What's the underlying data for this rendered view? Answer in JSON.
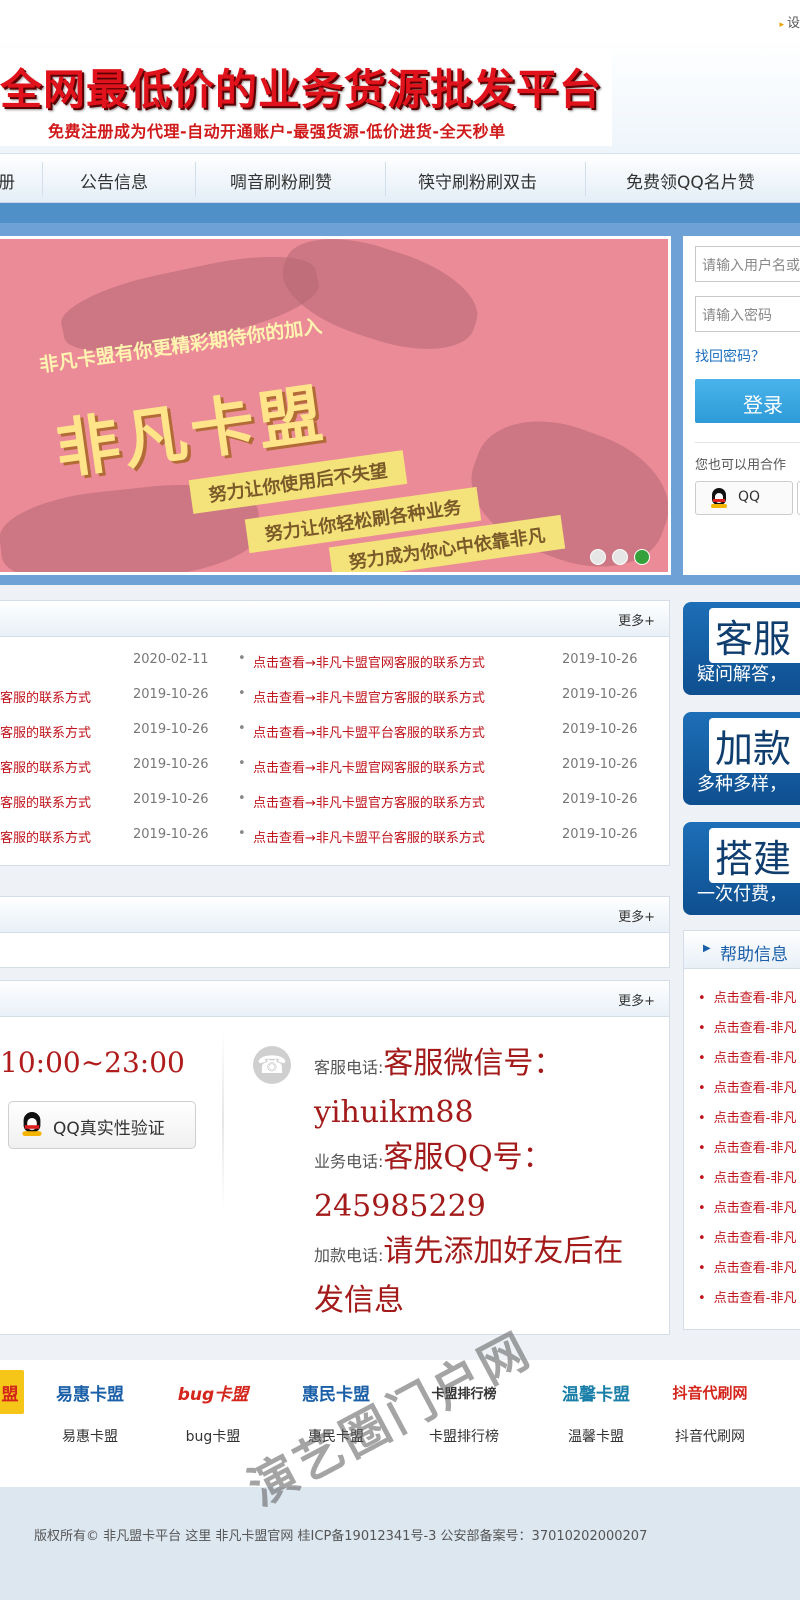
{
  "topbar": {
    "settings_label": "设"
  },
  "header": {
    "slogan": "全网最低价的业务货源批发平台",
    "subslogan": "免费注册成为代理-自动开通账户-最强货源-低价进货-全天秒单"
  },
  "nav": {
    "items": [
      {
        "label": "册"
      },
      {
        "label": "公告信息"
      },
      {
        "label": "啁音刷粉刷赞"
      },
      {
        "label": "筷守刷粉刷双击"
      },
      {
        "label": "免费领QQ名片赞"
      }
    ]
  },
  "slider": {
    "tagline": "非凡卡盟有你更精彩期待你的加入",
    "brand": "非凡卡盟",
    "bands": [
      "努力让你使用后不失望",
      "努力让你轻松刷各种业务",
      "努力成为你心中依靠非凡"
    ],
    "dots": 3,
    "active_dot": 3
  },
  "login": {
    "username_placeholder": "请输入用户名或",
    "password_placeholder": "请输入密码",
    "forgot_label": "找回密码？",
    "login_label": "登录",
    "other_label": "您也可以用合作",
    "qq_label": "QQ"
  },
  "news": {
    "more_label": "更多+",
    "rows": [
      {
        "left_title": "",
        "left_date": "2020-02-11",
        "right_title": "点击查看→非凡卡盟官网客服的联系方式",
        "right_date": "2019-10-26"
      },
      {
        "left_title": "客服的联系方式",
        "left_date": "2019-10-26",
        "right_title": "点击查看→非凡卡盟官方客服的联系方式",
        "right_date": "2019-10-26"
      },
      {
        "left_title": "客服的联系方式",
        "left_date": "2019-10-26",
        "right_title": "点击查看→非凡卡盟平台客服的联系方式",
        "right_date": "2019-10-26"
      },
      {
        "left_title": "客服的联系方式",
        "left_date": "2019-10-26",
        "right_title": "点击查看→非凡卡盟官网客服的联系方式",
        "right_date": "2019-10-26"
      },
      {
        "left_title": "客服的联系方式",
        "left_date": "2019-10-26",
        "right_title": "点击查看→非凡卡盟官方客服的联系方式",
        "right_date": "2019-10-26"
      },
      {
        "left_title": "客服的联系方式",
        "left_date": "2019-10-26",
        "right_title": "点击查看→非凡卡盟平台客服的联系方式",
        "right_date": "2019-10-26"
      }
    ]
  },
  "panel2": {
    "more_label": "更多+"
  },
  "contact": {
    "more_label": "更多+",
    "hours": "10:00~23:00",
    "verify_label": "QQ真实性验证",
    "service_label": "客服电话:",
    "service_value": "客服微信号：yihuikm88",
    "business_label": "业务电话:",
    "business_value": "客服QQ号：245985229",
    "funds_label": "加款电话:",
    "funds_value": "请先添加好友后在发信息"
  },
  "ads": [
    {
      "title": "客服",
      "sub": "疑问解答，"
    },
    {
      "title": "加款",
      "sub": "多种多样，"
    },
    {
      "title": "搭建",
      "sub": "一次付费，"
    }
  ],
  "help": {
    "title": "帮助信息",
    "items": [
      "点击查看-非凡",
      "点击查看-非凡",
      "点击查看-非凡",
      "点击查看-非凡",
      "点击查看-非凡",
      "点击查看-非凡",
      "点击查看-非凡",
      "点击查看-非凡",
      "点击查看-非凡",
      "点击查看-非凡",
      "点击查看-非凡"
    ]
  },
  "links": [
    {
      "logo": "盟",
      "name": "",
      "color": "#d4261c"
    },
    {
      "logo": "易惠卡盟",
      "name": "易惠卡盟",
      "color": "#1a5fa8"
    },
    {
      "logo": "bug卡盟",
      "name": "bug卡盟",
      "color": "#d4261c"
    },
    {
      "logo": "惠民卡盟",
      "name": "惠民卡盟",
      "color": "#1a5fa8"
    },
    {
      "logo": "卡盟排行榜",
      "name": "卡盟排行榜",
      "color": "#333333"
    },
    {
      "logo": "温馨卡盟",
      "name": "温馨卡盟",
      "color": "#1a7fa8"
    },
    {
      "logo": "抖音代刷网",
      "name": "抖音代刷网",
      "color": "#d4261c"
    }
  ],
  "footer": {
    "copyright": "版权所有©  非凡盟卡平台   这里  非凡卡盟官网   桂ICP备19012341号-3   公安部备案号：37010202000207"
  },
  "watermark": "演艺圈门户网",
  "colors": {
    "accent_blue": "#4f90c9",
    "link_red": "#c0131c",
    "login_blue": "#2e9bd8"
  }
}
